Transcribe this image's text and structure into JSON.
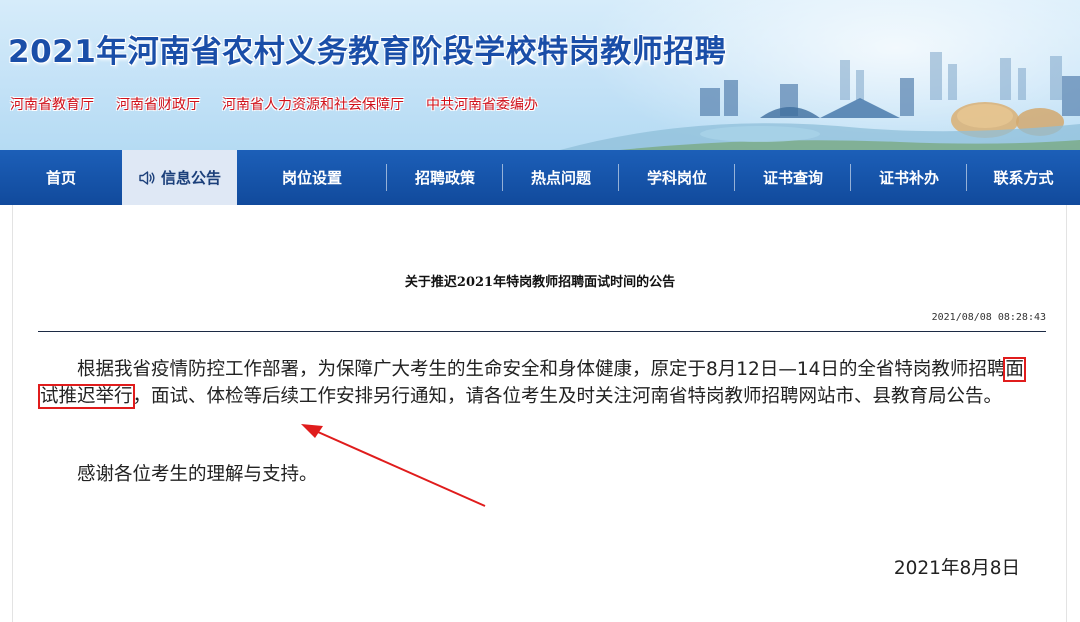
{
  "banner": {
    "title": "2021年河南省农村义务教育阶段学校特岗教师招聘",
    "links": [
      "河南省教育厅",
      "河南省财政厅",
      "河南省人力资源和社会保障厅",
      "中共河南省委编办"
    ]
  },
  "nav": {
    "items": [
      {
        "label": "首页"
      },
      {
        "label": "信息公告",
        "active": true
      },
      {
        "label": "岗位设置"
      },
      {
        "label": "招聘政策"
      },
      {
        "label": "热点问题"
      },
      {
        "label": "学科岗位"
      },
      {
        "label": "证书查询"
      },
      {
        "label": "证书补办"
      },
      {
        "label": "联系方式"
      }
    ]
  },
  "notice": {
    "title": "关于推迟2021年特岗教师招聘面试时间的公告",
    "timestamp": "2021/08/08 08:28:43",
    "para1_before": "根据我省疫情防控工作部署，为保障广大考生的生命安全和身体健康，原定于8月12日—14日的全省特岗教师招聘",
    "para1_highlight": "面试推迟举行",
    "para1_after": "，面试、体检等后续工作安排另行通知，请各位考生及时关注河南省特岗教师招聘网站市、县教育局公告。",
    "para2": "感谢各位考生的理解与支持。",
    "date": "2021年8月8日"
  },
  "colors": {
    "nav_bg": "#114a9c",
    "nav_active_bg": "#dfe8f5",
    "banner_title": "#1a4ea8",
    "banner_link": "#d0101a",
    "annotation_red": "#e01c1c"
  }
}
